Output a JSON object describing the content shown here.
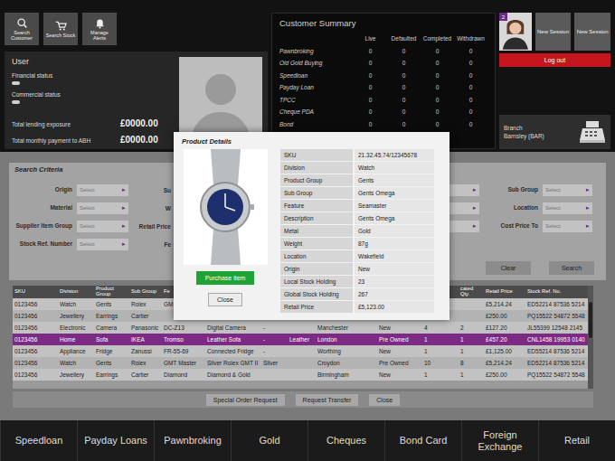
{
  "toolbar": [
    {
      "label": "Search Customer"
    },
    {
      "label": "Search Stock"
    },
    {
      "label": "Manage Alerts"
    }
  ],
  "user": {
    "title": "User",
    "statuses": [
      {
        "label": "Financial status",
        "on": false
      },
      {
        "label": "Commercial status",
        "on": false
      }
    ],
    "totals": [
      {
        "label": "Total lending exposure",
        "value": "£0000.00"
      },
      {
        "label": "Total monthly payment to ABH",
        "value": "£0000.00"
      }
    ]
  },
  "customer_summary": {
    "title": "Customer Summary",
    "columns": [
      "Live",
      "Defaulted",
      "Completed",
      "Withdrawn"
    ],
    "rows": [
      {
        "label": "Pawnbroking",
        "values": [
          "0",
          "0",
          "0",
          "0"
        ]
      },
      {
        "label": "Old Gold Buying",
        "values": [
          "0",
          "0",
          "0",
          "0"
        ]
      },
      {
        "label": "Speedloan",
        "values": [
          "0",
          "0",
          "0",
          "0"
        ]
      },
      {
        "label": "Payday Loan",
        "values": [
          "0",
          "0",
          "0",
          "0"
        ]
      },
      {
        "label": "TPCC",
        "values": [
          "0",
          "0",
          "0",
          "0"
        ]
      },
      {
        "label": "Cheque PDA",
        "values": [
          "0",
          "0",
          "0",
          "0"
        ]
      },
      {
        "label": "Bond",
        "values": [
          "0",
          "0",
          "0",
          "0"
        ]
      }
    ]
  },
  "session": {
    "alert_badge": "2",
    "new_session_buttons": [
      "New Session",
      "New Session"
    ],
    "logout": "Log out"
  },
  "branch": {
    "label": "Branch",
    "value": "Barnsley (BAR)"
  },
  "search": {
    "title": "Search Criteria",
    "arrow": "▸",
    "left_fields": [
      {
        "label": "Origin",
        "placeholder": "Select",
        "next_label": "Su"
      },
      {
        "label": "Material",
        "placeholder": "Select",
        "next_label": "W"
      },
      {
        "label": "Supplier Item Group",
        "placeholder": "Select",
        "next_label": "Retail Price"
      },
      {
        "label": "Stock Ref. Number",
        "placeholder": "Select",
        "next_label": "Fe"
      }
    ],
    "right_fields": [
      {
        "label": "Sub Group",
        "placeholder": "Select"
      },
      {
        "label": "Location",
        "placeholder": "Select"
      },
      {
        "label": "Cost Price To",
        "placeholder": "Select"
      }
    ],
    "buttons": [
      "Clear",
      "Search"
    ]
  },
  "table": {
    "columns": [
      "SKU",
      "Division",
      "Product Group",
      "Sub Group",
      "Fe",
      "",
      "",
      "",
      "",
      "",
      "",
      "cated Qty.",
      "Retail Price",
      "Stock Ref. No."
    ],
    "rows": [
      {
        "selected": false,
        "cells": [
          "0123456",
          "Watch",
          "Gents",
          "Rolex",
          "GM",
          "",
          "",
          "",
          "",
          "",
          "",
          "",
          "£5,214.24",
          "ED52214 87536 5214"
        ]
      },
      {
        "selected": false,
        "cells": [
          "0123456",
          "Jewellery",
          "Earrings",
          "Cartier",
          "",
          "",
          "",
          "",
          "",
          "",
          "",
          "",
          "£250.00",
          "PQ15522 54872 5548"
        ]
      },
      {
        "selected": false,
        "cells": [
          "0123456",
          "Electronic",
          "Camera",
          "Panasonic",
          "DC-Z13",
          "Digital Camera",
          "-",
          "",
          "Manchester",
          "New",
          "4",
          "2",
          "£127.20",
          "JL55399 12548 2145"
        ]
      },
      {
        "selected": true,
        "cells": [
          "0123456",
          "Home",
          "Sofa",
          "IKEA",
          "Tromso",
          "Leather Sofa",
          "-",
          "Leather",
          "London",
          "Pre Owned",
          "1",
          "1",
          "£457.20",
          "CNL1458 19953 0140"
        ]
      },
      {
        "selected": false,
        "cells": [
          "0123456",
          "Appliance",
          "Fridge",
          "Zanussi",
          "FR-55-69",
          "Connected Fridge",
          "-",
          "",
          "Worthing",
          "New",
          "1",
          "1",
          "£1,125.00",
          "ED55214 87536 5214"
        ]
      },
      {
        "selected": false,
        "cells": [
          "0123456",
          "Watch",
          "Gents",
          "Rolex",
          "GMT Master",
          "Silver Rolex GMT II",
          "Silver",
          "",
          "Croydon",
          "Pre Owned",
          "10",
          "8",
          "£5,214.24",
          "ED52214 87536 5214"
        ]
      },
      {
        "selected": false,
        "cells": [
          "0123456",
          "Jewellery",
          "Earrings",
          "Cartier",
          "Diamond",
          "Diamond & Gold",
          "",
          "",
          "Birmingham",
          "New",
          "1",
          "1",
          "£250.00",
          "PQ15522 54872 5548"
        ]
      }
    ]
  },
  "actions": [
    "Special Order Request",
    "Request Transfer",
    "Close"
  ],
  "nav": [
    {
      "label": "Speedloan",
      "selected": false
    },
    {
      "label": "Payday Loans",
      "selected": false
    },
    {
      "label": "Pawnbroking",
      "selected": false
    },
    {
      "label": "Gold",
      "selected": false
    },
    {
      "label": "Cheques",
      "selected": false
    },
    {
      "label": "Bond Card",
      "selected": false
    },
    {
      "label": "Foreign Exchange",
      "selected": false
    },
    {
      "label": "Retail",
      "selected": false
    }
  ],
  "modal": {
    "title": "Product Details",
    "purchase": "Purchase item",
    "close": "Close",
    "details": [
      {
        "label": "SKU",
        "value": "21.32.45.74/12345678"
      },
      {
        "label": "Division",
        "value": "Watch"
      },
      {
        "label": "Product Group",
        "value": "Gents"
      },
      {
        "label": "Sub Group",
        "value": "Gents Omega"
      },
      {
        "label": "Feature",
        "value": "Seamaster"
      },
      {
        "label": "Description",
        "value": "Gents Omega"
      },
      {
        "label": "Metal",
        "value": "Gold"
      },
      {
        "label": "Weight",
        "value": "87g"
      },
      {
        "label": "Location",
        "value": "Wakefield"
      },
      {
        "label": "Origin",
        "value": "New"
      },
      {
        "label": "Local Stock Holding",
        "value": "23"
      },
      {
        "label": "Global Stock Holding",
        "value": "267"
      },
      {
        "label": "Retail Price",
        "value": "£5,123.00"
      }
    ]
  }
}
